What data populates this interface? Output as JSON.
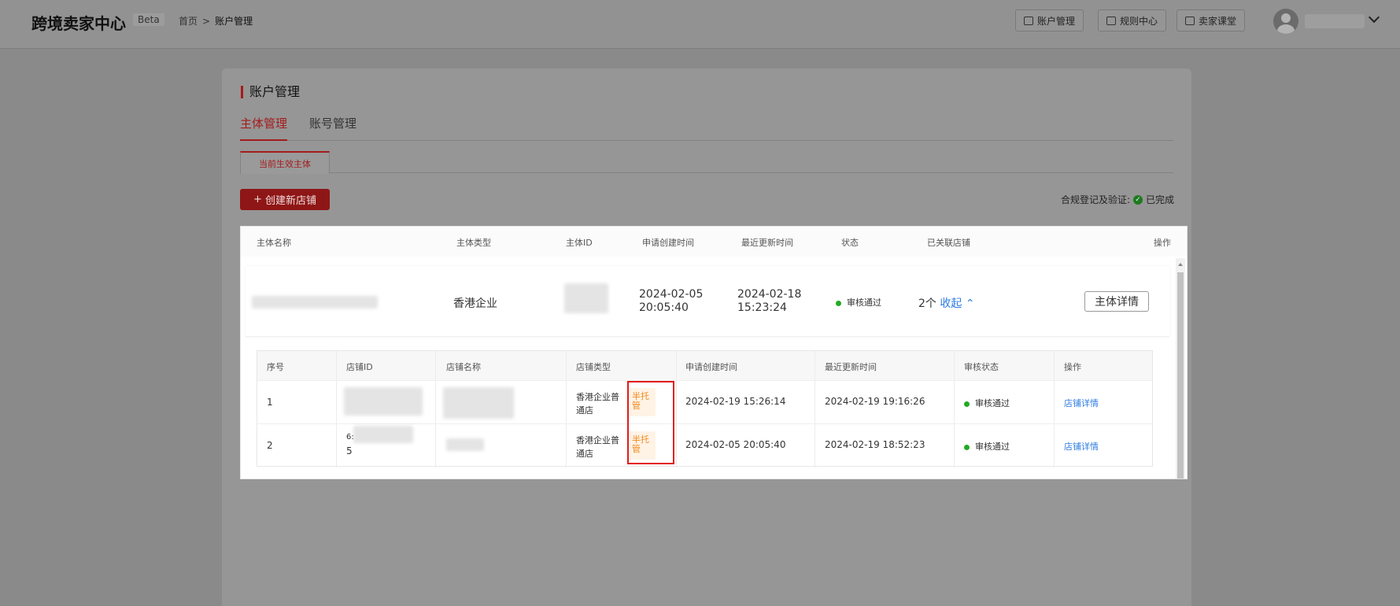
{
  "header": {
    "brand": "跨境卖家中心",
    "beta": "Beta",
    "breadcrumb": {
      "home": "首页",
      "separator": ">",
      "current": "账户管理"
    },
    "buttons": [
      {
        "label": "账户管理",
        "icon": "account-icon"
      },
      {
        "label": "规则中心",
        "icon": "rules-icon"
      },
      {
        "label": "卖家课堂",
        "icon": "book-icon"
      }
    ]
  },
  "page": {
    "title": "账户管理",
    "tabs": [
      "主体管理",
      "账号管理"
    ],
    "active_tab": "主体管理",
    "subtab": "当前生效主体",
    "create_button": "创建新店铺",
    "compliance_label": "合规登记及验证:",
    "compliance_status": "已完成"
  },
  "entity_table": {
    "columns": [
      "主体名称",
      "主体类型",
      "主体ID",
      "申请创建时间",
      "最近更新时间",
      "状态",
      "已关联店铺",
      "操作"
    ],
    "row": {
      "type": "香港企业",
      "created_date": "2024-02-05",
      "created_time": "20:05:40",
      "updated_date": "2024-02-18",
      "updated_time": "15:23:24",
      "status": "审核通过",
      "linked_stores": "2个",
      "collapse_link": "收起",
      "detail_button": "主体详情"
    }
  },
  "store_table": {
    "columns": [
      "序号",
      "店铺ID",
      "店铺名称",
      "店铺类型",
      "申请创建时间",
      "最近更新时间",
      "审核状态",
      "操作"
    ],
    "rows": [
      {
        "index": "1",
        "store_id": "",
        "type_line1": "香港企业普",
        "type_line2": "通店",
        "tag_line1": "半托",
        "tag_line2": "管",
        "created": "2024-02-19 15:26:14",
        "updated": "2024-02-19 19:16:26",
        "status": "审核通过",
        "action": "店铺详情"
      },
      {
        "index": "2",
        "store_id_line1": "6:",
        "store_id_line2": "5",
        "type_line1": "香港企业普",
        "type_line2": "通店",
        "tag_line1": "半托",
        "tag_line2": "管",
        "created": "2024-02-05 20:05:40",
        "updated": "2024-02-19 18:52:23",
        "status": "审核通过",
        "action": "店铺详情"
      }
    ]
  },
  "colors": {
    "accent_red": "#a51b1b",
    "highlight_box": "#e11b1b",
    "status_green": "#22aa22",
    "link_blue": "#2f7de1",
    "tag_orange": "#f08a1c"
  }
}
